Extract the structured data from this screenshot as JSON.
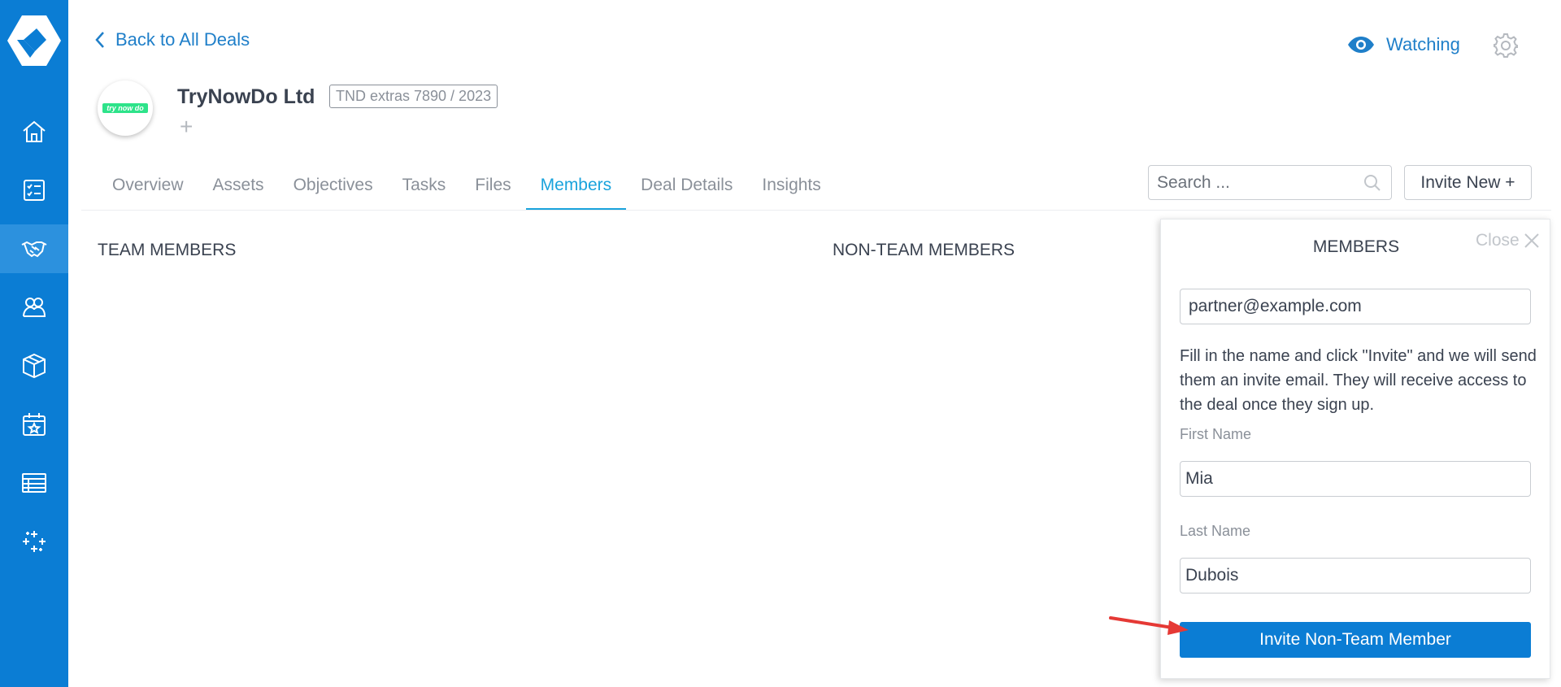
{
  "header": {
    "back_label": "Back to All Deals",
    "watching_label": "Watching"
  },
  "deal": {
    "company_name": "TryNowDo Ltd",
    "deal_tag": "TND extras 7890 / 2023",
    "logo_text": "try now do",
    "add_symbol": "+"
  },
  "tabs": [
    {
      "label": "Overview",
      "active": false
    },
    {
      "label": "Assets",
      "active": false
    },
    {
      "label": "Objectives",
      "active": false
    },
    {
      "label": "Tasks",
      "active": false
    },
    {
      "label": "Files",
      "active": false
    },
    {
      "label": "Members",
      "active": true
    },
    {
      "label": "Deal Details",
      "active": false
    },
    {
      "label": "Insights",
      "active": false
    }
  ],
  "toolbar": {
    "search_placeholder": "Search ...",
    "invite_new_label": "Invite New +"
  },
  "sections": {
    "team_members": "TEAM MEMBERS",
    "non_team_members": "NON-TEAM MEMBERS"
  },
  "panel": {
    "title": "MEMBERS",
    "close_label": "Close",
    "email_value": "partner@example.com",
    "help_text": "Fill in the name and click \"Invite\" and we will send them an invite email. They will receive access to the deal once they sign up.",
    "first_name_label": "First Name",
    "first_name_value": "Mia",
    "last_name_label": "Last Name",
    "last_name_value": "Dubois",
    "invite_button_label": "Invite Non-Team Member"
  },
  "sidebar": {
    "items": [
      {
        "icon": "home-icon",
        "active": false
      },
      {
        "icon": "checklist-icon",
        "active": false
      },
      {
        "icon": "handshake-icon",
        "active": true
      },
      {
        "icon": "people-icon",
        "active": false
      },
      {
        "icon": "box-icon",
        "active": false
      },
      {
        "icon": "calendar-star-icon",
        "active": false
      },
      {
        "icon": "table-icon",
        "active": false
      },
      {
        "icon": "sparkles-icon",
        "active": false
      }
    ]
  },
  "colors": {
    "sidebar": "#0b7dd4",
    "accent": "#1aa3dc",
    "link": "#1f7fc9",
    "annotation_arrow": "#e53935"
  }
}
